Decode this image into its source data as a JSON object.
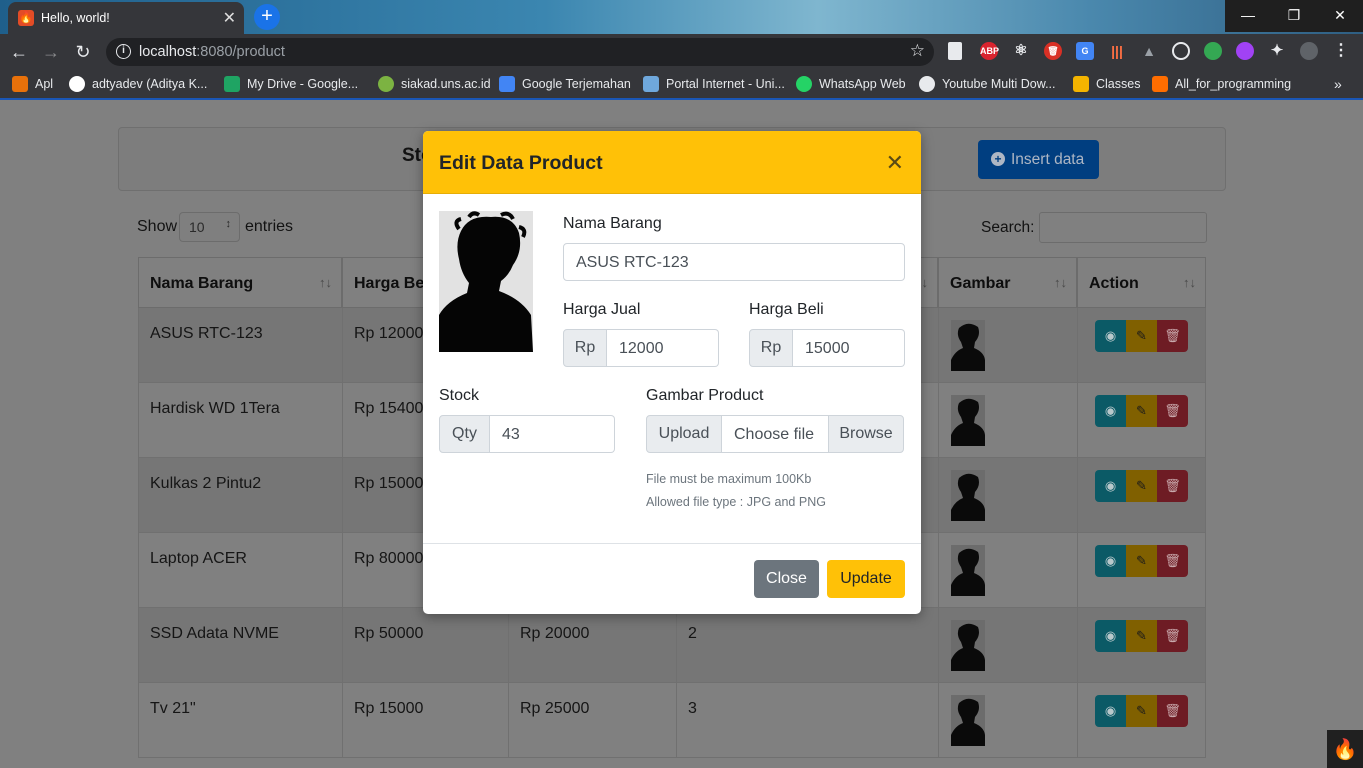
{
  "browser": {
    "tab_title": "Hello, world!",
    "url_host": "localhost",
    "url_rest": ":8080/product",
    "bookmarks": [
      {
        "label": "Apl",
        "icon": "apps-grid-icon",
        "color": "#e8710a"
      },
      {
        "label": "adtyadev (Aditya K...",
        "icon": "github-icon",
        "color": "#ffffff"
      },
      {
        "label": "My Drive - Google...",
        "icon": "google-drive-icon",
        "color": "#1fa463"
      },
      {
        "label": "siakad.uns.ac.id",
        "icon": "siakad-icon",
        "color": "#7cb342"
      },
      {
        "label": "Google Terjemahan",
        "icon": "google-translate-icon",
        "color": "#4285f4"
      },
      {
        "label": "Portal Internet - Uni...",
        "icon": "portal-icon",
        "color": "#6fa8dc"
      },
      {
        "label": "WhatsApp Web",
        "icon": "whatsapp-icon",
        "color": "#25d366"
      },
      {
        "label": "Youtube Multi Dow...",
        "icon": "globe-icon",
        "color": "#e8eaed"
      },
      {
        "label": "Classes",
        "icon": "classroom-icon",
        "color": "#f4b400"
      },
      {
        "label": "All_for_programming",
        "icon": "bookmark-folder-icon",
        "color": "#ff6d00"
      }
    ]
  },
  "page": {
    "header_title": "Stock",
    "insert_label": "Insert data",
    "show_label": "Show",
    "entries_value": "10",
    "entries_label": "entries",
    "search_label": "Search:",
    "columns": [
      "Nama Barang",
      "Harga Beli",
      "",
      "",
      "Gambar",
      "Action"
    ],
    "rows": [
      {
        "name": "ASUS RTC-123",
        "harga_beli": "Rp 12000",
        "harga_jual": "",
        "stock": ""
      },
      {
        "name": "Hardisk WD 1Tera",
        "harga_beli": "Rp 15400",
        "harga_jual": "",
        "stock": ""
      },
      {
        "name": "Kulkas 2 Pintu2",
        "harga_beli": "Rp 15000",
        "harga_jual": "",
        "stock": ""
      },
      {
        "name": "Laptop ACER",
        "harga_beli": "Rp 80000",
        "harga_jual": "",
        "stock": ""
      },
      {
        "name": "SSD Adata NVME",
        "harga_beli": "Rp 50000",
        "harga_jual": "Rp 20000",
        "stock": "2"
      },
      {
        "name": "Tv 21\"",
        "harga_beli": "Rp 15000",
        "harga_jual": "Rp 25000",
        "stock": "3"
      }
    ]
  },
  "modal": {
    "title": "Edit Data Product",
    "nama_label": "Nama Barang",
    "nama_value": "ASUS RTC-123",
    "harga_jual_label": "Harga Jual",
    "harga_jual_prefix": "Rp",
    "harga_jual_value": "12000",
    "harga_beli_label": "Harga Beli",
    "harga_beli_prefix": "Rp",
    "harga_beli_value": "15000",
    "stock_label": "Stock",
    "stock_prefix": "Qty",
    "stock_value": "43",
    "gambar_label": "Gambar Product",
    "upload_label": "Upload",
    "choose_label": "Choose file",
    "browse_label": "Browse",
    "hint_size": "File must be maximum 100Kb",
    "hint_type": "Allowed file type : JPG and PNG",
    "close_label": "Close",
    "update_label": "Update"
  },
  "colors": {
    "modal_header": "#ffc107",
    "close_button": "#6c757d",
    "update_button": "#ffc107",
    "insert_button": "#007bff"
  }
}
